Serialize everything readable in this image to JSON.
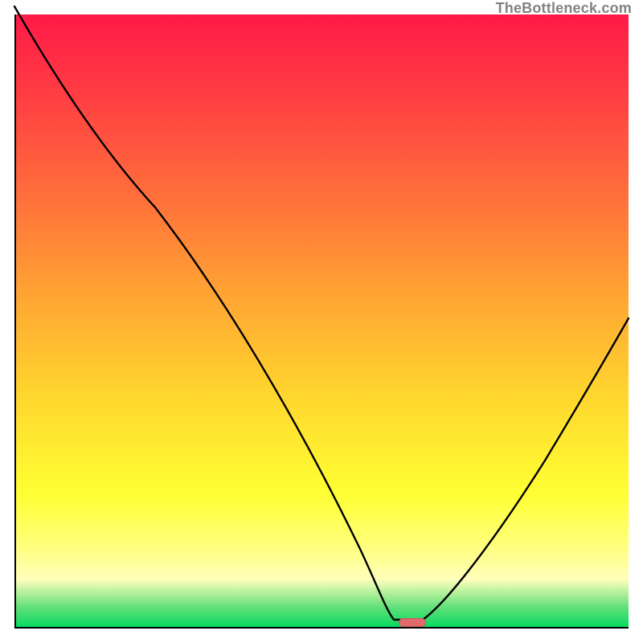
{
  "watermark": "TheBottleneck.com",
  "marker": {
    "x_frac": 0.648,
    "y_frac": 0.991
  },
  "chart_data": {
    "type": "line",
    "title": "",
    "xlabel": "",
    "ylabel": "",
    "xlim": [
      0,
      1
    ],
    "ylim": [
      0,
      1
    ],
    "series": [
      {
        "name": "bottleneck-curve",
        "x": [
          0.0,
          0.1,
          0.2,
          0.3,
          0.4,
          0.5,
          0.58,
          0.62,
          0.66,
          0.7,
          0.8,
          0.9,
          1.0
        ],
        "y": [
          1.0,
          0.84,
          0.7,
          0.55,
          0.4,
          0.24,
          0.08,
          0.02,
          0.02,
          0.05,
          0.18,
          0.3,
          0.43
        ]
      }
    ],
    "marker": {
      "x": 0.648,
      "y": 0.009,
      "color": "#e06a6a"
    },
    "background_gradient": [
      "#ff1a47",
      "#ffd62e",
      "#ffff33",
      "#00d95e"
    ]
  }
}
